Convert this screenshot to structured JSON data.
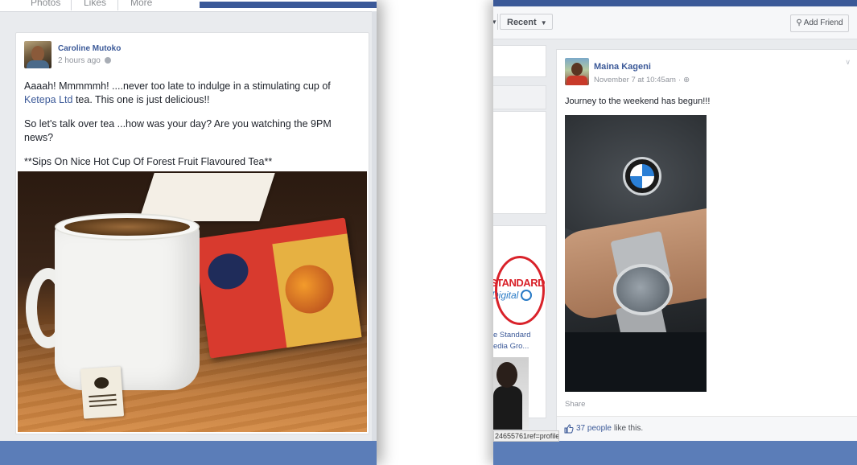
{
  "left_post": {
    "top_tabs": [
      "Photos",
      "Likes",
      "More"
    ],
    "author": "Caroline Mutoko",
    "time": "2 hours ago",
    "text_line1_a": "Aaaah! Mmmmmh! ....never too late to indulge in a stimulating cup of ",
    "text_line1_link": "Ketepa Ltd",
    "text_line1_b": " tea. This one is just delicious!!",
    "text_line2": "So let's talk over tea ...how was your day? Are you watching the 9PM news?",
    "text_line3": "**Sips On Nice Hot Cup Of Forest Fruit Flavoured Tea**",
    "photo_icon": "tea-mug-photo"
  },
  "right_post": {
    "recent_label": "Recent",
    "add_friend_label": "Add Friend",
    "sidebar": {
      "standard_logo_text": "STANDARD",
      "standard_logo_sub": "Digital",
      "standard_caption_1": "e Standard",
      "standard_caption_2": "edia Gro...",
      "status_url": "24655761ref=profile"
    },
    "author": "Maina Kageni",
    "time": "November 7 at 10:45am",
    "text": "Journey to the weekend has begun!!!",
    "share_label": "Share",
    "likes_count": "37 people",
    "likes_suffix": "like this.",
    "photo_icon": "bmw-watch-photo"
  },
  "colors": {
    "facebook_blue": "#3b5998",
    "link_blue": "#3b5998",
    "bottom_bar": "#5b7db8",
    "page_bg": "#e9ebee"
  }
}
